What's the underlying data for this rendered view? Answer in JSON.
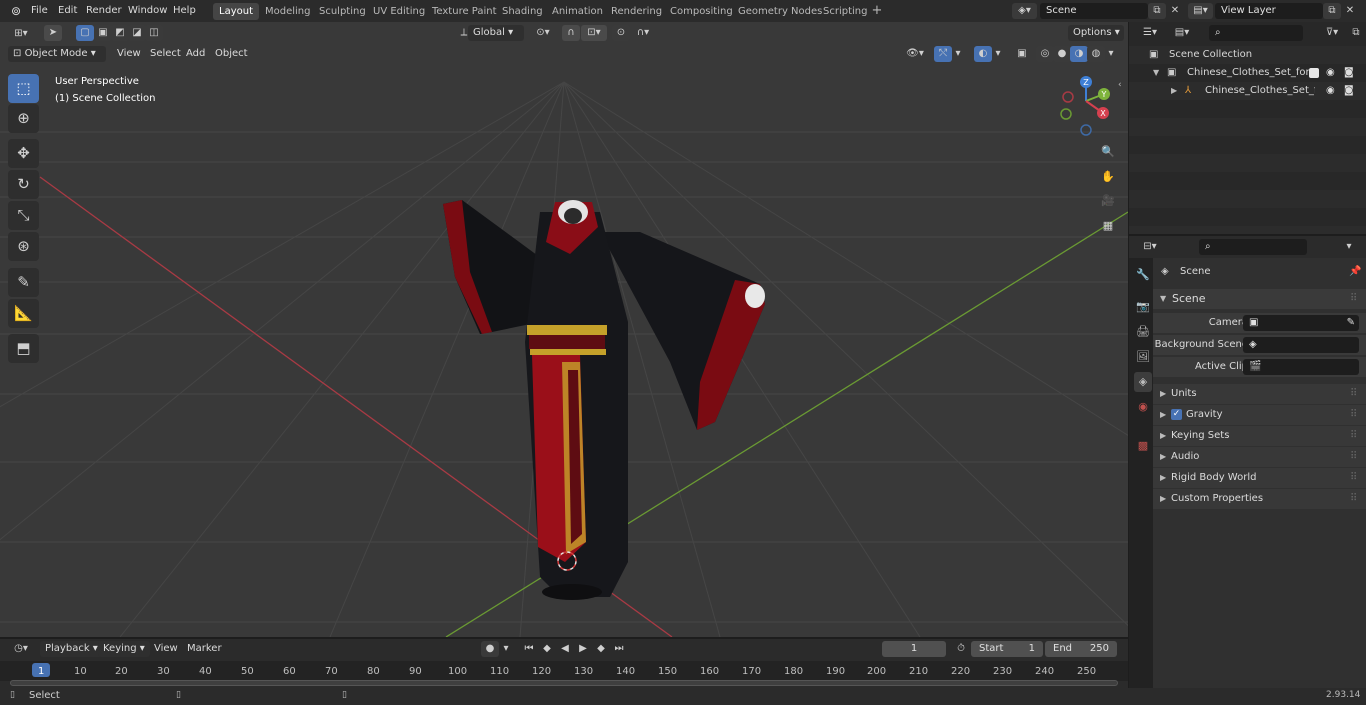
{
  "topbar": {
    "menus": [
      "File",
      "Edit",
      "Render",
      "Window",
      "Help"
    ],
    "workspaces": [
      "Layout",
      "Modeling",
      "Sculpting",
      "UV Editing",
      "Texture Paint",
      "Shading",
      "Animation",
      "Rendering",
      "Compositing",
      "Geometry Nodes",
      "Scripting"
    ],
    "active_workspace": "Layout",
    "add_tab": "+",
    "scene_name": "Scene",
    "view_layer": "View Layer"
  },
  "viewport": {
    "mode": "Object Mode",
    "menus": [
      "View",
      "Select",
      "Add",
      "Object"
    ],
    "orientation": "Global",
    "options_label": "Options",
    "overlay_line1": "User Perspective",
    "overlay_line2": "(1) Scene Collection",
    "gizmo_axes": {
      "x": "X",
      "y": "Y",
      "z": "Z"
    }
  },
  "timeline": {
    "menus": [
      "Playback",
      "Keying",
      "View",
      "Marker"
    ],
    "current_frame": "1",
    "start_label": "Start",
    "start_value": "1",
    "end_label": "End",
    "end_value": "250",
    "ticks": [
      "1",
      "10",
      "20",
      "30",
      "40",
      "50",
      "60",
      "70",
      "80",
      "90",
      "100",
      "110",
      "120",
      "130",
      "140",
      "150",
      "160",
      "170",
      "180",
      "190",
      "200",
      "210",
      "220",
      "230",
      "240",
      "250"
    ]
  },
  "statusbar": {
    "left": "Select",
    "version": "2.93.14"
  },
  "outliner": {
    "root": "Scene Collection",
    "item1": "Chinese_Clothes_Set_for_Mar",
    "item2": "Chinese_Clothes_Set_for"
  },
  "properties": {
    "header": "Scene",
    "panel_title": "Scene",
    "fields": [
      {
        "label": "Camera"
      },
      {
        "label": "Background Scene"
      },
      {
        "label": "Active Clip"
      }
    ],
    "sections": [
      "Units",
      "Gravity",
      "Keying Sets",
      "Audio",
      "Rigid Body World",
      "Custom Properties"
    ],
    "gravity_checked": true
  },
  "colors": {
    "accent": "#4772b3",
    "x_axis": "#d5404f",
    "y_axis": "#7eb33c",
    "z_axis": "#3e7fd6"
  }
}
